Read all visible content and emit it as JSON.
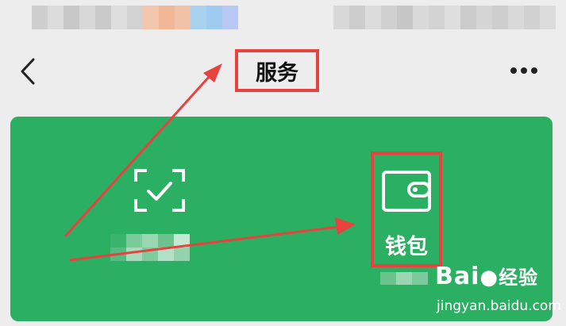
{
  "nav": {
    "title": "服务"
  },
  "card": {
    "wallet_label": "钱包"
  },
  "watermark": {
    "brand": "Bai",
    "brand_suffix": "经验",
    "url": "jingyan.baidu.com"
  },
  "colors": {
    "background": "#ededed",
    "card_green": "#2aaf63",
    "highlight_red": "#e8413e",
    "icon_white": "#ffffff"
  },
  "icons": {
    "back": "chevron-left-icon",
    "more": "ellipsis-icon",
    "scan": "scan-check-icon",
    "wallet": "wallet-icon",
    "watermark_paw": "paw-icon"
  }
}
